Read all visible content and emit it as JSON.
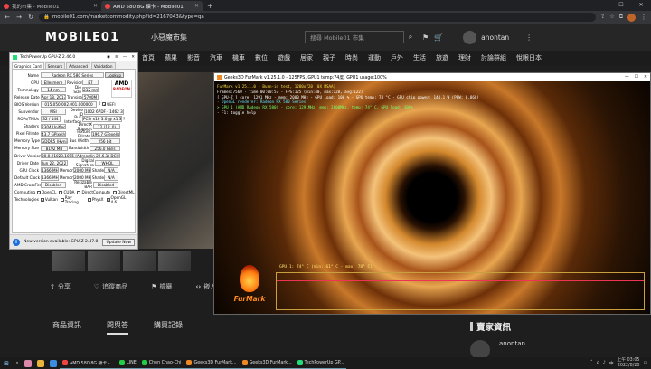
{
  "browser": {
    "tabs": [
      {
        "title": "我的市集 - Mobile01",
        "active": false
      },
      {
        "title": "AMD 580 8G 礦卡 - Mobile01",
        "active": true
      }
    ],
    "new_tab": "+",
    "url": "mobile01.com/marketcommodity.php?id=2167043&type=qa"
  },
  "site": {
    "logo": "MOBILE01",
    "section": "小惡魔市集",
    "search_placeholder": "搜尋 Mobile01 市集",
    "username": "anontan",
    "nav": [
      "首頁",
      "蘋果",
      "影音",
      "汽車",
      "機車",
      "數位",
      "遊戲",
      "居家",
      "親子",
      "時尚",
      "運動",
      "戶外",
      "生活",
      "旅遊",
      "理財",
      "討論群組",
      "悅眼日本"
    ]
  },
  "product": {
    "photo_label": "卡",
    "actions": [
      "分享",
      "追蹤商品",
      "檢舉",
      "嵌入"
    ],
    "tabs": [
      "商品資訊",
      "問與答",
      "購買記錄"
    ],
    "active_tab": 1,
    "seller_title": "賣家資訊",
    "seller_name": "anontan"
  },
  "gpuz": {
    "title": "TechPowerUp GPU-Z 2.46.0",
    "tabs": [
      "Graphics Card",
      "Sensors",
      "Advanced",
      "Validation"
    ],
    "name_label": "Name",
    "name": "Radeon RX 580 Series",
    "lookup": "Lookup",
    "logo_text": "AMD",
    "logo_sub": "RADEON",
    "uefi": "UEFI",
    "rows": [
      {
        "label": "GPU",
        "cells": [
          "Ellesmere",
          "Revision",
          "E7"
        ]
      },
      {
        "label": "Technology",
        "cells": [
          "14 nm",
          "Die Size",
          "232 mm²"
        ]
      },
      {
        "label": "Release Date",
        "cells": [
          "Apr 18, 2017",
          "Transistors",
          "5700M"
        ]
      },
      {
        "label": "BIOS Version",
        "cells": [
          "015.050.002.001.000000"
        ]
      },
      {
        "label": "Subvendor",
        "cells": [
          "MSI",
          "Device ID",
          "1002 67DF - 1462 3416"
        ]
      },
      {
        "label": "ROPs/TMUs",
        "cells": [
          "32 / 144",
          "Bus Interface",
          "PCIe x16 3.0 @ x1 3.0"
        ]
      },
      {
        "label": "Shaders",
        "cells": [
          "2304 Unified",
          "DirectX Support",
          "12 (12_0)"
        ]
      },
      {
        "label": "Pixel Fillrate",
        "cells": [
          "43.7 GPixel/s",
          "Texture Fillrate",
          "196.7 GTexel/s"
        ]
      },
      {
        "label": "Memory Type",
        "cells": [
          "GDDR5 (Hynix)",
          "Bus Width",
          "256 bit"
        ]
      },
      {
        "label": "Memory Size",
        "cells": [
          "8192 MB",
          "Bandwidth",
          "256.0 GB/s"
        ]
      },
      {
        "label": "Driver Version",
        "cells": [
          "30.0.21023.1015 (Adrenalin 22.6.1) DCH / Win10 64"
        ]
      },
      {
        "label": "Driver Date",
        "cells": [
          "Jun 22, 2022",
          "Digital Signature",
          "WHQL"
        ]
      },
      {
        "label": "GPU Clock",
        "cells": [
          "1366 MHz",
          "Memory",
          "2000 MHz",
          "Shader",
          "N/A"
        ]
      },
      {
        "label": "Default Clock",
        "cells": [
          "1366 MHz",
          "Memory",
          "2000 MHz",
          "Shader",
          "N/A"
        ]
      },
      {
        "label": "AMD CrossFire",
        "cells": [
          "Disabled",
          "Resizable BAR",
          "Disabled"
        ]
      }
    ],
    "computing_label": "Computing",
    "computing": [
      {
        "label": "OpenCL",
        "checked": true
      },
      {
        "label": "CUDA",
        "checked": false
      },
      {
        "label": "DirectCompute",
        "checked": true
      },
      {
        "label": "DirectML",
        "checked": true
      }
    ],
    "technologies_label": "Technologies",
    "technologies": [
      {
        "label": "Vulkan",
        "checked": true
      },
      {
        "label": "Ray Tracing",
        "checked": false
      },
      {
        "label": "PhysX",
        "checked": false
      },
      {
        "label": "OpenGL 4.6",
        "checked": true
      }
    ],
    "select_value": "Radeon RX 580 Series",
    "close": "Close",
    "notice": "New version available: GPU-Z 2.47.0",
    "update": "Update Now"
  },
  "furmark": {
    "title": "Geeks3D FurMark v1.25.1.0 - 125FPS, GPU1 temp:74度, GPU1 usage:100%",
    "hud": [
      {
        "text": "FurMark v1.25.1.0 - Burn-in test, 1280x720 (0X MSAA)",
        "color": "y"
      },
      {
        "text": "Frames:7560 - time:00:00:57 - FPS:125 (min:40, max:128, avg:122)",
        "color": "w"
      },
      {
        "text": "[ GPU-Z ] core: 1291 MHz - mem: 2000 MHz - GPU load: 100 % - GPU temp: 74 °C - GPU chip power: 144.1 W (PPW: 0.868)",
        "color": "w"
      },
      {
        "text": "- OpenGL renderer: Radeon RX 580 Series",
        "color": "c"
      },
      {
        "text": "> GPU 1 (AMD Radeon RX 580) - core: 1291MHz, mem: 2000MHz, temp: 74° C, GPU load: 100%",
        "color": "g"
      },
      {
        "text": "- F1: toggle help",
        "color": "w"
      }
    ],
    "graph_label": "GPU 1: 74° C (min: 61° C - max: 78° C)",
    "logo_text": "FurMark"
  },
  "taskbar": {
    "items": [
      {
        "label": "AMD 580 8G 礦卡 -...",
        "color": "#e44"
      },
      {
        "label": "LINE",
        "color": "#2c4"
      },
      {
        "label": "Chen Chao-Chi",
        "color": "#2c4"
      },
      {
        "label": "Geeks3D FurMark...",
        "color": "#e82"
      },
      {
        "label": "Geeks3D FurMark...",
        "color": "#e82"
      },
      {
        "label": "TechPowerUp GP...",
        "color": "#2d7"
      }
    ],
    "lang": "中",
    "time": "上午 03:05",
    "date": "2022/8/20"
  }
}
